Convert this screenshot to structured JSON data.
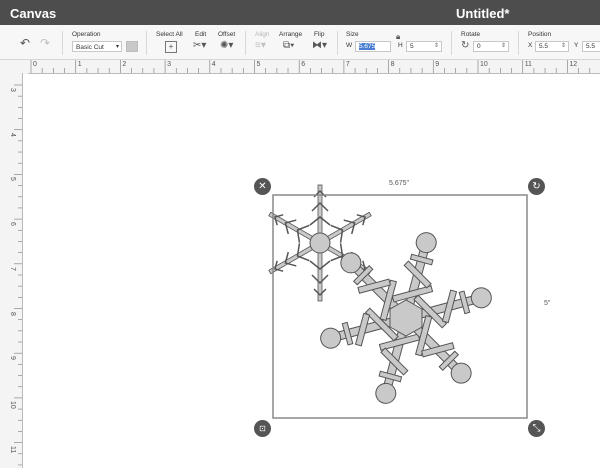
{
  "app": {
    "title": "Canvas",
    "document_title": "Untitled*"
  },
  "toolbar": {
    "operation": {
      "label": "Operation",
      "value": "Basic Cut"
    },
    "select_all": {
      "label": "Select All"
    },
    "edit": {
      "label": "Edit"
    },
    "offset": {
      "label": "Offset"
    },
    "align": {
      "label": "Align"
    },
    "arrange": {
      "label": "Arrange"
    },
    "flip": {
      "label": "Flip"
    },
    "size": {
      "label": "Size",
      "w_label": "W",
      "w_value": "5.675",
      "h_label": "H",
      "h_value": "5"
    },
    "rotate": {
      "label": "Rotate",
      "value": "0"
    },
    "position": {
      "label": "Position",
      "x_label": "X",
      "x_value": "5.5",
      "y_label": "Y",
      "y_value": "5.5"
    }
  },
  "ruler": {
    "horizontal": [
      "0",
      "1",
      "2",
      "3",
      "4",
      "5",
      "6",
      "7",
      "8",
      "9",
      "10",
      "11",
      "12"
    ],
    "vertical": [
      "3",
      "4",
      "5",
      "6",
      "7",
      "8",
      "9",
      "10",
      "11"
    ]
  },
  "selection": {
    "width_label": "5.675\"",
    "height_label": "5\""
  },
  "colors": {
    "titlebar": "#4d4d4d",
    "shape_fill": "#c9c9c9",
    "shape_stroke": "#555555",
    "highlight": "#4a7fd0"
  }
}
